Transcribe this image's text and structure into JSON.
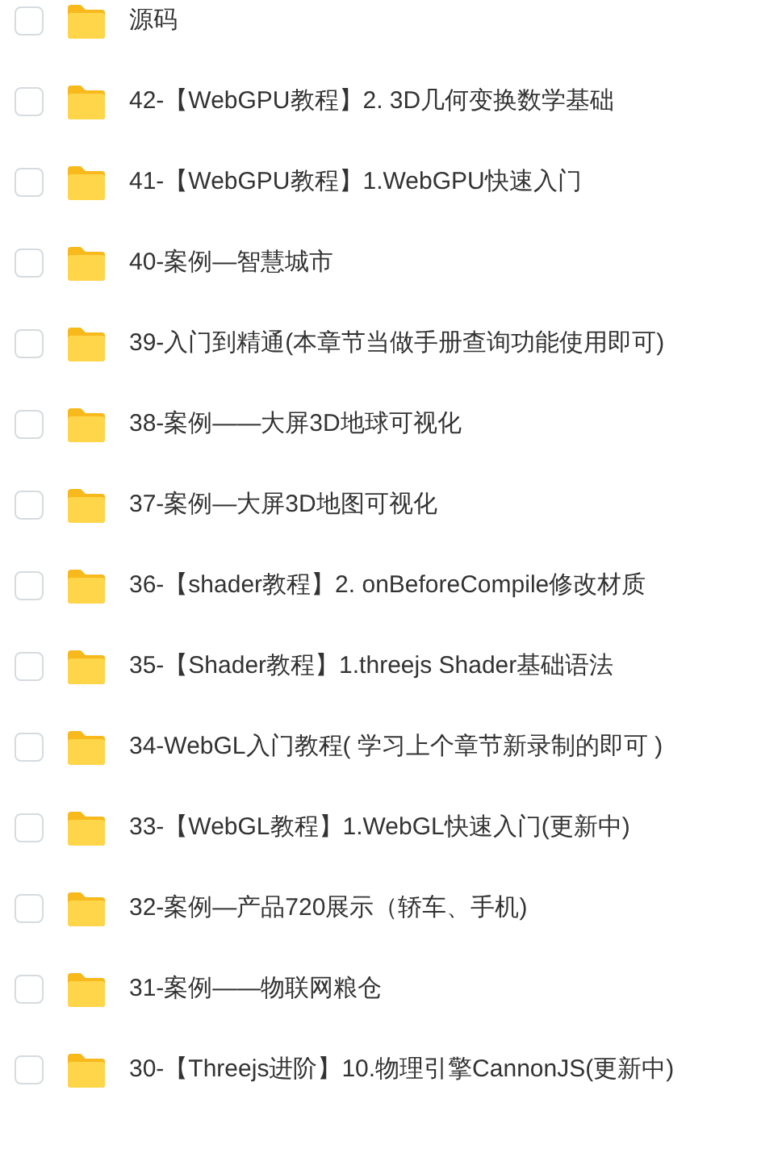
{
  "folders": [
    {
      "name": "源码",
      "checked": false
    },
    {
      "name": "42-【WebGPU教程】2. 3D几何变换数学基础",
      "checked": false
    },
    {
      "name": "41-【WebGPU教程】1.WebGPU快速入门",
      "checked": false
    },
    {
      "name": "40-案例—智慧城市",
      "checked": false
    },
    {
      "name": "39-入门到精通(本章节当做手册查询功能使用即可)",
      "checked": false
    },
    {
      "name": "38-案例——大屏3D地球可视化",
      "checked": false
    },
    {
      "name": "37-案例—大屏3D地图可视化",
      "checked": false
    },
    {
      "name": "36-【shader教程】2. onBeforeCompile修改材质",
      "checked": false
    },
    {
      "name": "35-【Shader教程】1.threejs Shader基础语法",
      "checked": false
    },
    {
      "name": "34-WebGL入门教程( 学习上个章节新录制的即可 )",
      "checked": false
    },
    {
      "name": "33-【WebGL教程】1.WebGL快速入门(更新中)",
      "checked": false
    },
    {
      "name": "32-案例—产品720展示（轿车、手机)",
      "checked": false
    },
    {
      "name": "31-案例——物联网粮仓",
      "checked": false
    },
    {
      "name": "30-【Threejs进阶】10.物理引擎CannonJS(更新中)",
      "checked": false
    }
  ]
}
